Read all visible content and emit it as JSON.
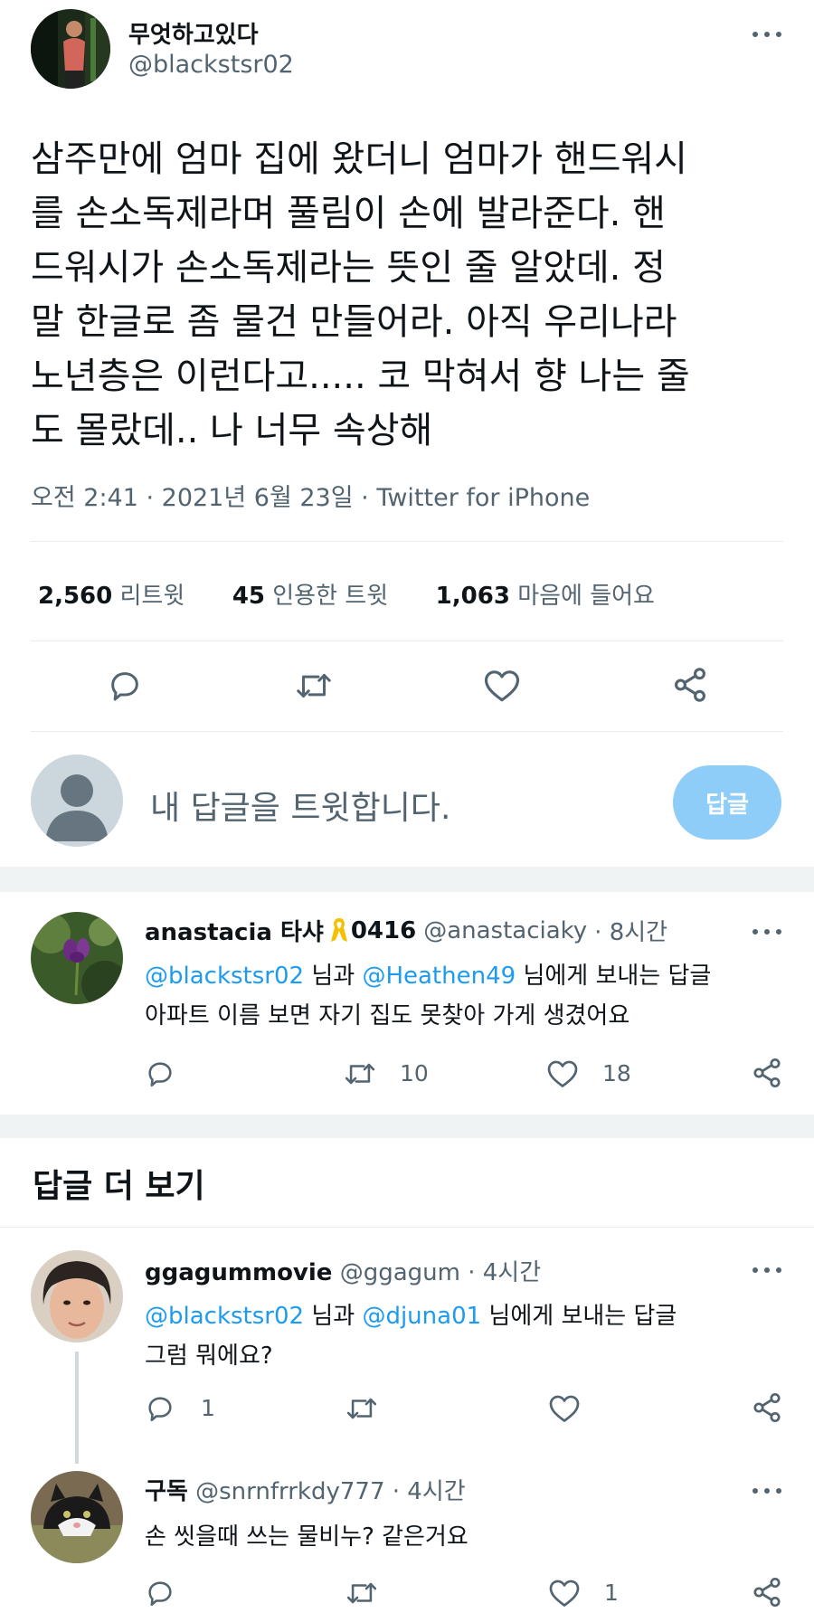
{
  "main_tweet": {
    "display_name": "무엇하고있다",
    "handle": "@blackstsr02",
    "text_lines": [
      "삼주만에 엄마 집에 왔더니 엄마가 핸드워시",
      "를 손소독제라며 풀림이 손에 발라준다. 핸",
      "드워시가 손소독제라는 뜻인 줄 알았데. 정",
      "말 한글로 좀 물건 만들어라. 아직 우리나라",
      "노년층은 이런다고..... 코 막혀서 향 나는 줄",
      "도 몰랐데.. 나 너무 속상해"
    ],
    "timestamp": "오전 2:41 · 2021년 6월 23일 · Twitter for iPhone",
    "retweets_count": "2,560",
    "retweets_label": "리트윗",
    "quotes_count": "45",
    "quotes_label": "인용한 트윗",
    "likes_count": "1,063",
    "likes_label": "마음에 들어요"
  },
  "composer": {
    "placeholder": "내 답글을 트윗합니다.",
    "button_label": "답글"
  },
  "replies": [
    {
      "display_name": "anastacia 타샤",
      "name_suffix": "0416",
      "handle": "@anastaciaky",
      "time": "· 8시간",
      "replying_to_1": "@blackstsr02",
      "replying_mid": "님과",
      "replying_to_2": "@Heathen49",
      "replying_tail": "님에게 보내는 답글",
      "text": "아파트 이름 보면 자기 집도 못찾아 가게 생겼어요",
      "retweets": "10",
      "likes": "18"
    }
  ],
  "more_replies_title": "답글 더 보기",
  "thread": [
    {
      "display_name": "ggagummovie",
      "handle": "@ggagum",
      "time": "· 4시간",
      "replying_to_1": "@blackstsr02",
      "replying_mid": "님과",
      "replying_to_2": "@djuna01",
      "replying_tail": "님에게 보내는 답글",
      "text": "그럼 뭐에요?",
      "replies": "1"
    },
    {
      "display_name": "구독",
      "handle": "@snrnfrrkdy777",
      "time": "· 4시간",
      "text": "손 씻을때 쓰는 물비누? 같은거요",
      "likes": "1"
    }
  ],
  "colors": {
    "accent": "#1d9bf0",
    "reply_button_bg": "#8ecdf7",
    "muted_text": "#536471",
    "ribbon": "#f5c000"
  }
}
